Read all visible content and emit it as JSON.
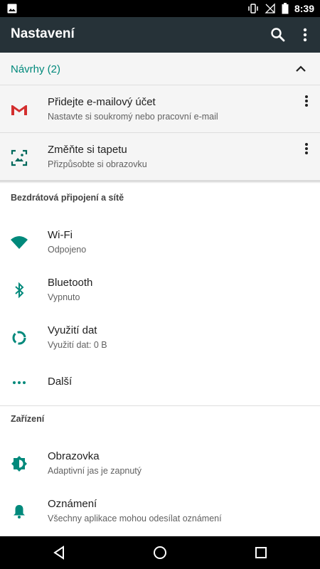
{
  "status_bar": {
    "time": "8:39",
    "icons": [
      "image-icon",
      "vibrate-icon",
      "no-signal-icon",
      "battery-icon"
    ]
  },
  "app_bar": {
    "title": "Nastavení",
    "actions": [
      "search-icon",
      "more-vert-icon"
    ]
  },
  "suggestions": {
    "header": "Návrhy (2)",
    "items": [
      {
        "icon": "gmail-icon",
        "title": "Přidejte e-mailový účet",
        "subtitle": "Nastavte si soukromý nebo pracovní e-mail"
      },
      {
        "icon": "wallpaper-icon",
        "title": "Změňte si tapetu",
        "subtitle": "Přizpůsobte si obrazovku"
      }
    ]
  },
  "sections": [
    {
      "title": "Bezdrátová připojení a sítě",
      "items": [
        {
          "icon": "wifi-icon",
          "title": "Wi-Fi",
          "subtitle": "Odpojeno"
        },
        {
          "icon": "bluetooth-icon",
          "title": "Bluetooth",
          "subtitle": "Vypnuto"
        },
        {
          "icon": "data-usage-icon",
          "title": "Využití dat",
          "subtitle": "Využití dat: 0 B"
        },
        {
          "icon": "more-horiz-icon",
          "title": "Další"
        }
      ]
    },
    {
      "title": "Zařízení",
      "items": [
        {
          "icon": "brightness-icon",
          "title": "Obrazovka",
          "subtitle": "Adaptivní jas je zapnutý"
        },
        {
          "icon": "bell-icon",
          "title": "Oznámení",
          "subtitle": "Všechny aplikace mohou odesílat oznámení"
        }
      ]
    }
  ],
  "nav_bar": [
    "back-icon",
    "home-icon",
    "recents-icon"
  ],
  "colors": {
    "accent": "#00897b",
    "app_bar": "#263238",
    "gmail_red": "#d32f2f",
    "suggestion_bg": "#f5f5f5"
  }
}
